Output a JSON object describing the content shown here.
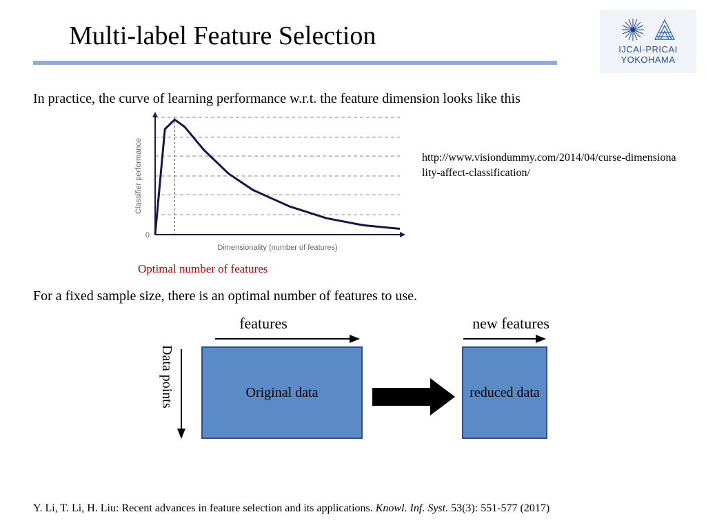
{
  "title": "Multi-label Feature Selection",
  "logo": {
    "line1": "IJCAI-PRICAI",
    "line2": "YOKOHAMA"
  },
  "body": {
    "line1": "In practice, the curve of learning performance w.r.t. the feature dimension looks like this",
    "optimal": "Optimal number of features",
    "line2": "For a fixed sample size, there is an optimal number of features to use.",
    "url": "http://www.visiondummy.com/2014/04/curse-dimensionality-affect-classification/"
  },
  "diagram": {
    "data_points": "Data points",
    "features": "features",
    "new_features": "new features",
    "original": "Original data",
    "reduced": "reduced data"
  },
  "citation": {
    "authors": "Y. Li, T. Li, H. Liu: Recent advances in feature selection and its applications. ",
    "journal": "Knowl. Inf. Syst.",
    "rest": " 53(3): 551-577 (2017)"
  },
  "chart_data": {
    "type": "line",
    "title": "",
    "xlabel": "Dimensionality (number of features)",
    "ylabel": "Classifier performance",
    "x": [
      0,
      0.04,
      0.08,
      0.12,
      0.2,
      0.3,
      0.4,
      0.55,
      0.7,
      0.85,
      1.0
    ],
    "y": [
      0,
      0.9,
      0.98,
      0.92,
      0.72,
      0.52,
      0.38,
      0.24,
      0.14,
      0.08,
      0.05
    ],
    "ylim": [
      0,
      1
    ],
    "xlim": [
      0,
      1
    ],
    "gridlines_y": [
      0.17,
      0.34,
      0.5,
      0.67,
      0.83,
      1.0
    ],
    "optimal_x": 0.08,
    "annotations": [
      "0"
    ]
  }
}
